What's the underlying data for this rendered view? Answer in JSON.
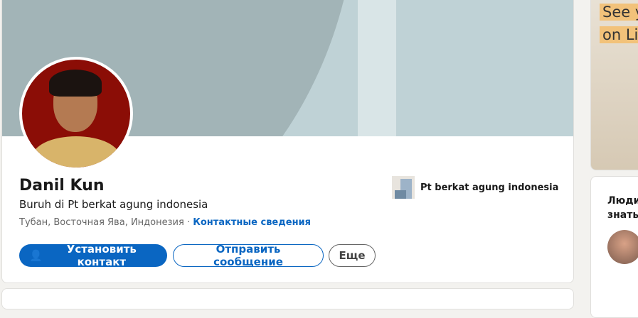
{
  "profile": {
    "name": "Danil Kun",
    "headline": "Buruh di Pt berkat agung indonesia",
    "location": "Тубан, Восточная Ява, Индонезия",
    "separator": " · ",
    "contact_info": "Контактные сведения"
  },
  "actions": {
    "connect": "Установить контакт",
    "message": "Отправить сообщение",
    "more": "Еще"
  },
  "company": {
    "name": "Pt berkat agung indonesia"
  },
  "ad": {
    "line1": "See y",
    "line2": "on Li"
  },
  "pymk": {
    "title_line1": "Люди",
    "title_line2": "знать"
  },
  "colors": {
    "primary": "#0a66c2",
    "background": "#f3f2ef"
  }
}
